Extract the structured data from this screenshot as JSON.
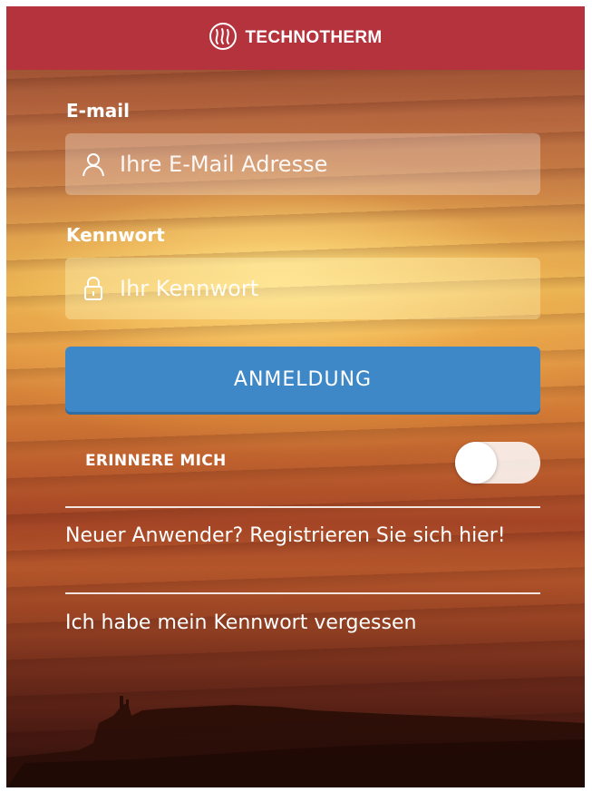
{
  "header": {
    "brand_name": "TECHNOTHERM",
    "brand_color": "#b5333d",
    "logo_icon": "flame-waves-icon"
  },
  "email": {
    "label": "E-mail",
    "placeholder": "Ihre E-Mail Adresse",
    "value": "",
    "icon": "user-icon"
  },
  "password": {
    "label": "Kennwort",
    "placeholder": "Ihr Kennwort",
    "value": "",
    "icon": "lock-icon"
  },
  "login_button": {
    "label": "ANMELDUNG",
    "color": "#3f88c8"
  },
  "remember": {
    "label": "ERINNERE MICH",
    "checked": false
  },
  "links": {
    "register": "Neuer Anwender? Registrieren Sie sich hier!",
    "forgot": "Ich habe mein Kennwort vergessen"
  }
}
